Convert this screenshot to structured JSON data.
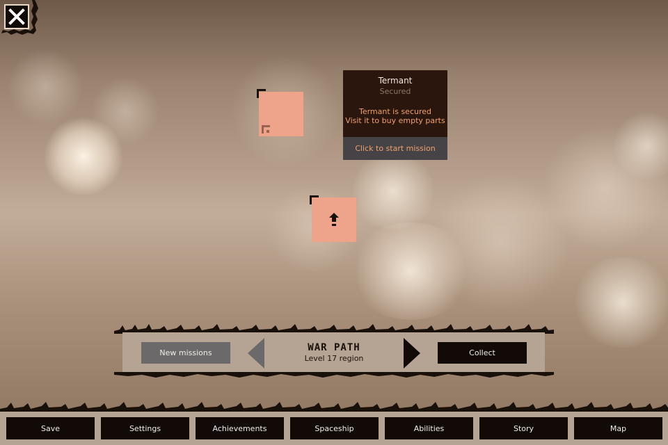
{
  "window": {
    "close_icon": "close-icon"
  },
  "map_nodes": [
    {
      "name": "map-node-termant",
      "icon": "corner-bracket-icon"
    },
    {
      "name": "map-node-upload",
      "icon": "up-arrow-icon"
    }
  ],
  "tooltip": {
    "title": "Termant",
    "status": "Secured",
    "line1": "Termant is secured",
    "line2": "Visit it to buy empty parts",
    "action": "Click to start mission"
  },
  "mission_panel": {
    "new_missions_label": "New missions",
    "region_title": "WAR PATH",
    "region_subtitle": "Level 17 region",
    "collect_label": "Collect",
    "prev_icon": "triangle-left-icon",
    "next_icon": "triangle-right-icon"
  },
  "nav": {
    "save": "Save",
    "settings": "Settings",
    "achievements": "Achievements",
    "spaceship": "Spaceship",
    "abilities": "Abilities",
    "story": "Story",
    "map": "Map"
  },
  "colors": {
    "node": "#eea48a",
    "tooltip_bg": "#2a160c",
    "tooltip_accent": "#f0a06e",
    "button_dark": "#120a06",
    "button_grey": "#6b6969",
    "panel": "#b5a393"
  }
}
